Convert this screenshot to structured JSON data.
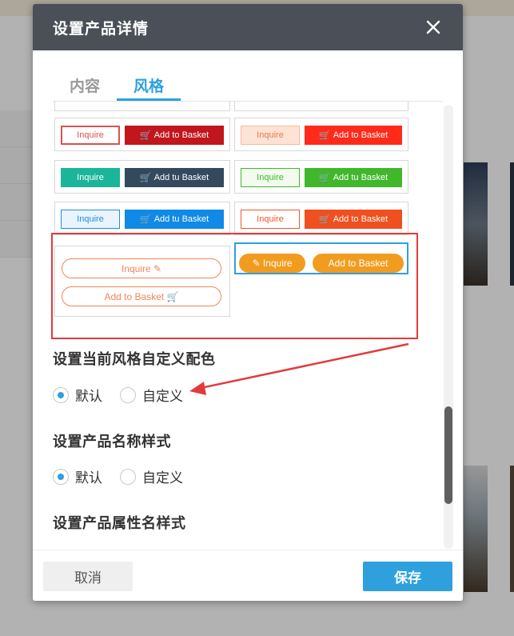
{
  "dialog": {
    "title": "设置产品详情",
    "close_icon": "close-icon"
  },
  "tabs": [
    {
      "label": "内容",
      "active": false
    },
    {
      "label": "风格",
      "active": true
    }
  ],
  "style_cards": [
    {
      "inquire": "Inquire",
      "basket": "Add to Basket"
    },
    {
      "inquire": "Inquire",
      "basket": "Add to Basket"
    },
    {
      "inquire": "Inquire",
      "basket": "Add tu Basket"
    },
    {
      "inquire": "Inquire",
      "basket": "Add tu Basket"
    },
    {
      "inquire": "Inquire",
      "basket": "Add tu Basket"
    },
    {
      "inquire": "Inquire",
      "basket": "Add to Basket"
    },
    {
      "inquire": "Inquire",
      "basket": "Add to Basket"
    },
    {
      "inquire": "Inquire",
      "basket": "Add to Basket"
    }
  ],
  "sections": {
    "custom_color": {
      "title": "设置当前风格自定义配色",
      "options": [
        "默认",
        "自定义"
      ],
      "selected": "默认"
    },
    "name_style": {
      "title": "设置产品名称样式",
      "options": [
        "默认",
        "自定义"
      ],
      "selected": "默认"
    },
    "attr_style": {
      "title": "设置产品属性名样式"
    }
  },
  "footer": {
    "cancel_label": "取消",
    "save_label": "保存"
  },
  "colors": {
    "accent": "#2ea0de",
    "header_bg": "#4a4f58",
    "annotation_red": "#e23b3b",
    "orange": "#f29c1f"
  }
}
